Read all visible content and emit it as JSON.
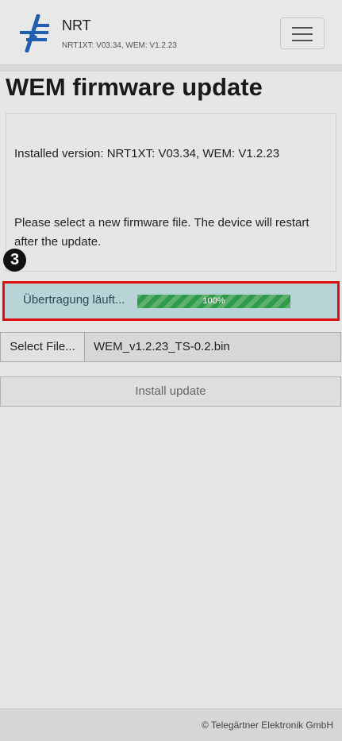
{
  "header": {
    "app_name": "NRT",
    "app_version": "NRT1XT: V03.34, WEM: V1.2.23",
    "logo_icon": "nrt-logo-icon",
    "menu_icon": "hamburger-menu-icon"
  },
  "page": {
    "title": "WEM firmware update"
  },
  "info": {
    "installed_version": "Installed version: NRT1XT: V03.34, WEM: V1.2.23",
    "instructions": "Please select a new firmware file. The device will restart after the update."
  },
  "annotation": {
    "step_number": "3"
  },
  "status": {
    "text": "Übertragung läuft...",
    "progress_label": "100%",
    "progress_fraction": 1.0
  },
  "file": {
    "select_label": "Select File...",
    "file_name": "WEM_v1.2.23_TS-0.2.bin"
  },
  "actions": {
    "install_label": "Install update"
  },
  "footer": {
    "copyright": "© Telegärtner Elektronik GmbH"
  },
  "colors": {
    "brand_blue": "#1f5fb0",
    "progress_green": "#2f9a48",
    "status_bg": "#b9d4d6",
    "highlight_red": "#e00d0d"
  }
}
